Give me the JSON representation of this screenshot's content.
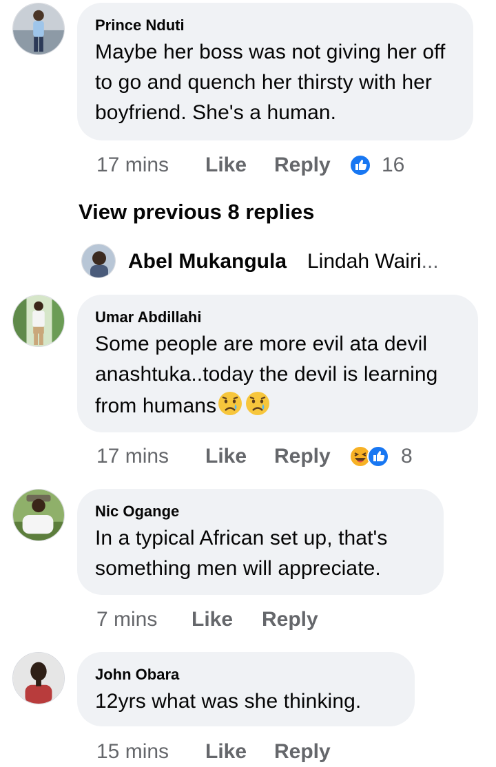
{
  "comments": [
    {
      "author": "Prince Nduti",
      "text": "Maybe her boss was not giving her off to go and quench her thirsty with her boyfriend. She's a human.",
      "time": "17 mins",
      "like": "Like",
      "reply": "Reply",
      "reactions": [
        "like-icon"
      ],
      "reaction_count": "16"
    },
    {
      "author": "Umar Abdillahi",
      "text": "Some people are more evil ata devil anashtuka..today the devil is learning from humans",
      "text_emojis": [
        "crying-face-icon",
        "crying-face-icon"
      ],
      "time": "17 mins",
      "like": "Like",
      "reply": "Reply",
      "reactions": [
        "haha-icon",
        "like-icon"
      ],
      "reaction_count": "8"
    },
    {
      "author": "Nic Ogange",
      "text": "In a typical African set up, that's something men will appreciate.",
      "time": "7 mins",
      "like": "Like",
      "reply": "Reply"
    },
    {
      "author": "John Obara",
      "text": "12yrs what was she thinking.",
      "time": "15 mins",
      "like": "Like",
      "reply": "Reply"
    }
  ],
  "view_previous": "View previous 8 replies",
  "reply_preview": {
    "author": "Abel Mukangula",
    "snippet": "Lindah Wairi",
    "ellipsis": "..."
  },
  "colors": {
    "bubble": "#f0f2f5",
    "text": "#050505",
    "meta": "#65676b",
    "like_blue": "#1877f2",
    "haha_yellow": "#f7b125"
  }
}
